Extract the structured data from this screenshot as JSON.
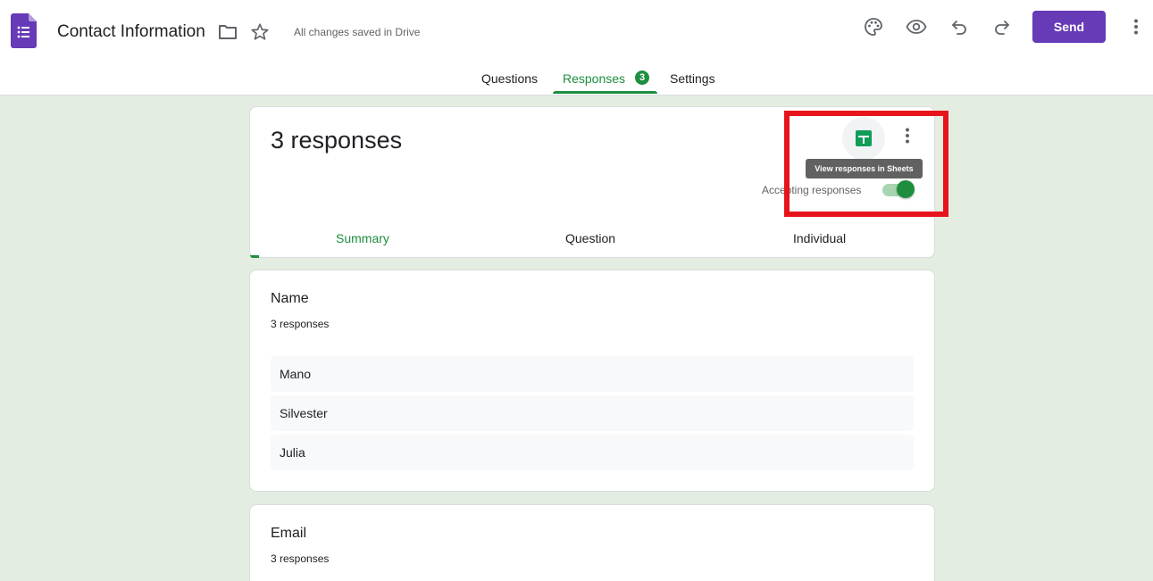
{
  "header": {
    "title": "Contact Information",
    "save_status": "All changes saved in Drive",
    "send_label": "Send",
    "icons": {
      "logo": "google-forms-logo",
      "folder": "folder-icon",
      "star": "star-icon",
      "palette": "palette-icon",
      "preview": "eye-icon",
      "undo": "undo-icon",
      "redo": "redo-icon",
      "more": "more-vert-icon"
    },
    "tabs": [
      {
        "label": "Questions"
      },
      {
        "label": "Responses",
        "badge": "3"
      },
      {
        "label": "Settings"
      }
    ]
  },
  "summary": {
    "count_title": "3 responses",
    "tooltip": "View responses in Sheets",
    "accepting_label": "Accepting responses",
    "accepting": true,
    "sub_tabs": [
      {
        "label": "Summary"
      },
      {
        "label": "Question"
      },
      {
        "label": "Individual"
      }
    ]
  },
  "questions": [
    {
      "title": "Name",
      "count": "3 responses",
      "answers": [
        "Mano",
        "Silvester",
        "Julia"
      ]
    },
    {
      "title": "Email",
      "count": "3 responses"
    }
  ],
  "colors": {
    "accent": "#673ab7",
    "green": "#1e8e3e",
    "background": "#e3ede1",
    "highlight": "#e8141c"
  }
}
